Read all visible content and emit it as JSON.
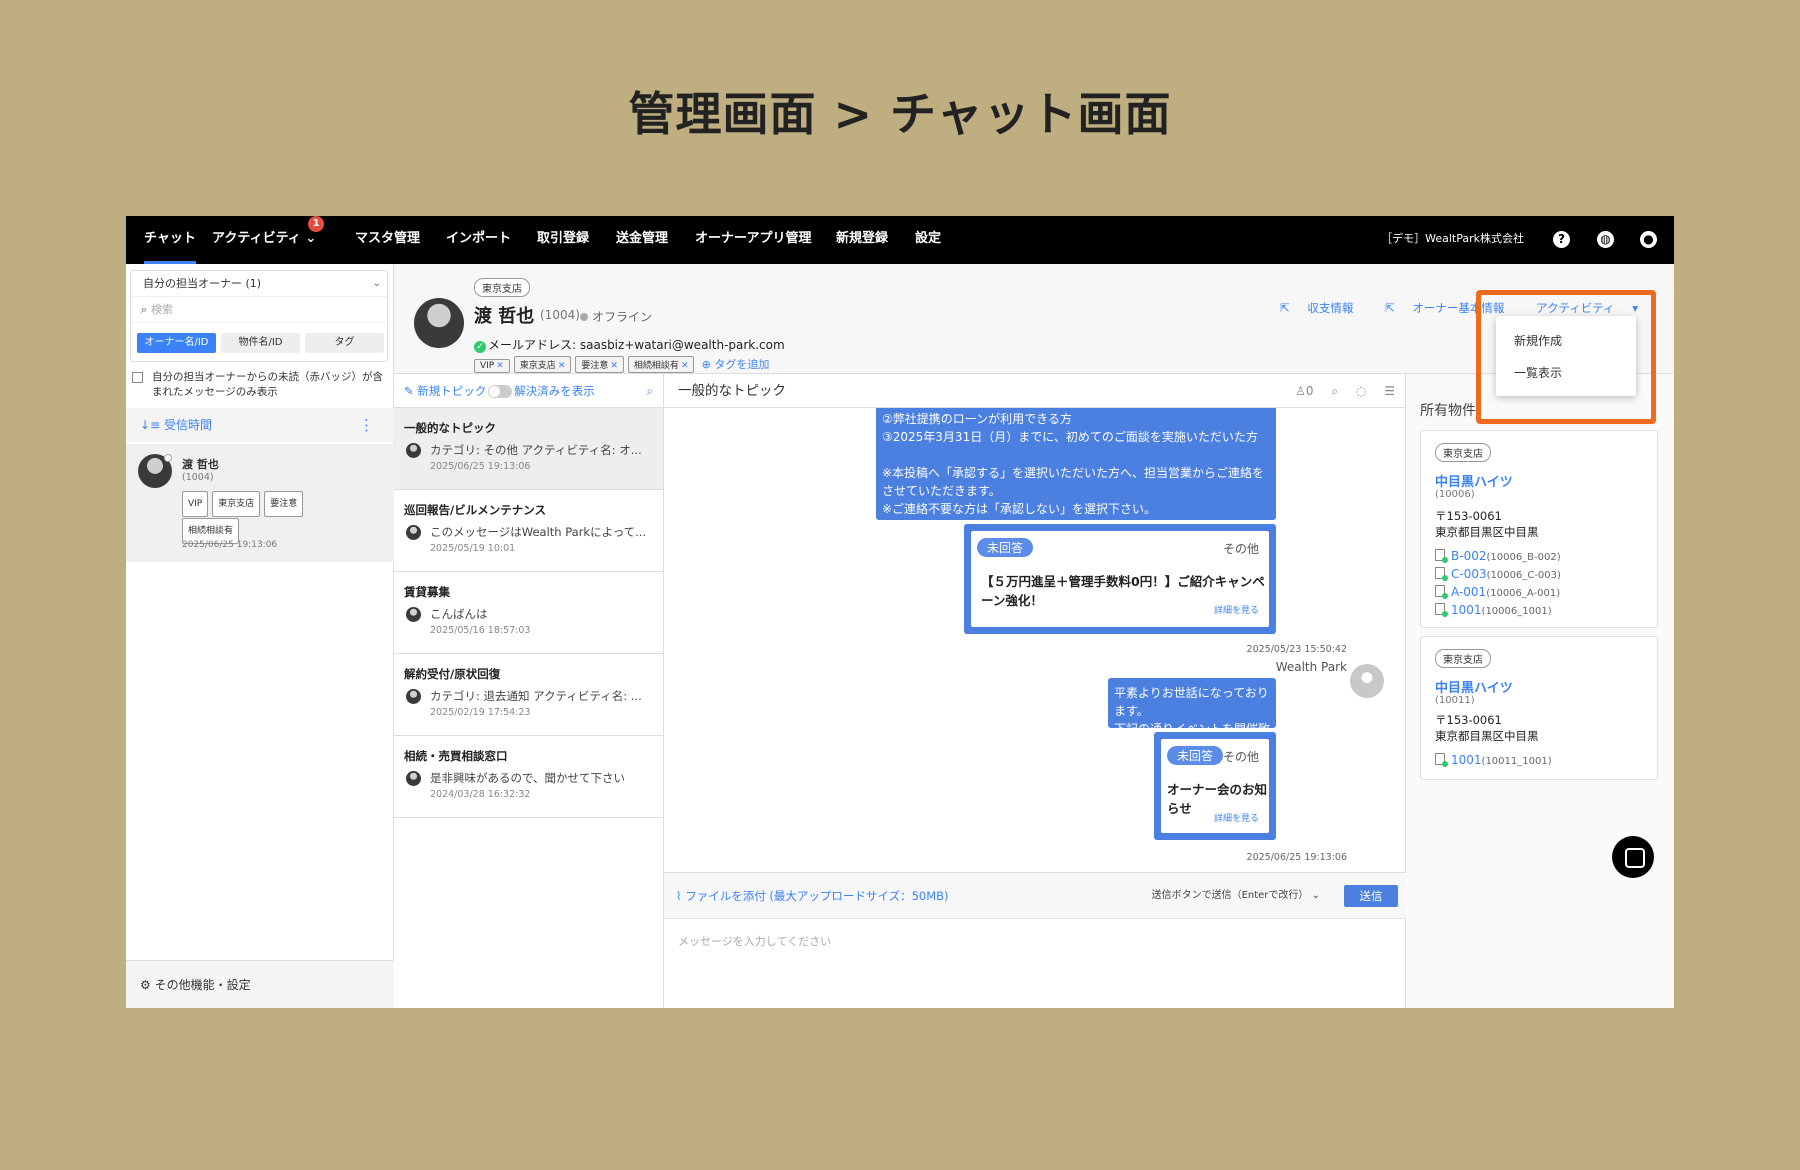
{
  "slide": {
    "title": "管理画面 > チャット画面"
  },
  "nav": {
    "items": [
      "チャット",
      "アクティビティ",
      "マスタ管理",
      "インポート",
      "取引登録",
      "送金管理",
      "オーナーアプリ管理",
      "新規登録",
      "設定"
    ],
    "activity_badge": "1",
    "company": "［デモ］WealtPark株式会社",
    "icons": [
      "help-icon",
      "globe-icon",
      "account-icon"
    ],
    "accent": "#3b82f6"
  },
  "left": {
    "owner_select": "自分の担当オーナー (1)",
    "search_placeholder": "検索",
    "segments": [
      "オーナー名/ID",
      "物件名/ID",
      "タグ"
    ],
    "unread_filter": "自分の担当オーナーからの未読（赤バッジ）が含まれたメッセージのみ表示",
    "sort_label": "受信時間",
    "contact": {
      "name": "渡 哲也",
      "id": "(1004)",
      "tags": [
        "VIP",
        "東京支店",
        "要注意",
        "相続相談有"
      ],
      "time": "2025/06/25 19:13:06"
    },
    "more": "その他機能・設定"
  },
  "header": {
    "branch": "東京支店",
    "name": "渡 哲也",
    "id": "(1004)",
    "status": "オフライン",
    "email": "メールアドレス: saasbiz+watari@wealth-park.com",
    "tags": [
      "VIP",
      "東京支店",
      "要注意",
      "相続相談有"
    ],
    "add_tag": "タグを追加",
    "links": [
      "収支情報",
      "オーナー基本情報",
      "アクティビティ"
    ],
    "dropdown": [
      "新規作成",
      "一覧表示"
    ]
  },
  "topics": {
    "new": "新規トピック",
    "resolved": "解決済みを表示",
    "items": [
      {
        "title": "一般的なトピック",
        "preview": "カテゴリ: その他 アクティビティ名: オ...",
        "time": "2025/06/25 19:13:06"
      },
      {
        "title": "巡回報告/ビルメンテナンス",
        "preview": "このメッセージはWealth Parkによって...",
        "time": "2025/05/19 10:01"
      },
      {
        "title": "賃貸募集",
        "preview": "こんばんは",
        "time": "2025/05/16 18:57:03"
      },
      {
        "title": "解約受付/原状回復",
        "preview": "カテゴリ: 退去通知 アクティビティ名: ...",
        "time": "2025/02/19 17:54:23"
      },
      {
        "title": "相続・売買相談窓口",
        "preview": "是非興味があるので、聞かせて下さい",
        "time": "2024/03/28 16:32:32"
      }
    ]
  },
  "chat": {
    "title": "一般的なトピック",
    "participants": "0",
    "msg1": [
      "②弊社提携のローンが利用できる方",
      "③2025年3月31日（月）までに、初めてのご面談を実施いただいた方",
      "",
      "※本投稿へ「承認する」を選択いただいた方へ、担当営業からご連絡をさせていただきます。",
      "※ご連絡不要な方は「承認しない」を選択下さい。"
    ],
    "card1": {
      "status": "未回答",
      "category": "その他",
      "title": "【５万円進呈＋管理手数料0円！】ご紹介キャンペーン強化！",
      "detail": "詳細を見る"
    },
    "time1": "2025/05/23 15:50:42",
    "sender": "Wealth Park",
    "msg2": [
      "平素よりお世話になっております。",
      "下記の通りイベントを開催致します。"
    ],
    "card2": {
      "status": "未回答",
      "category": "その他",
      "title": "オーナー会のお知らせ",
      "detail": "詳細を見る"
    },
    "time2": "2025/06/25 19:13:06",
    "attach": "ファイルを添付 (最大アップロードサイズ：50MB)",
    "send_mode": "送信ボタンで送信（Enterで改行）",
    "send": "送信",
    "placeholder": "メッセージを入力してください"
  },
  "props": {
    "title": "所有物件",
    "items": [
      {
        "branch": "東京支店",
        "name": "中目黒ハイツ",
        "id": "(10006)",
        "zip": "〒153-0061",
        "addr": "東京都目黒区中目黒",
        "units": [
          {
            "u": "B-002",
            "c": "(10006_B-002)"
          },
          {
            "u": "C-003",
            "c": "(10006_C-003)"
          },
          {
            "u": "A-001",
            "c": "(10006_A-001)"
          },
          {
            "u": "1001",
            "c": "(10006_1001)"
          }
        ]
      },
      {
        "branch": "東京支店",
        "name": "中目黒ハイツ",
        "id": "(10011)",
        "zip": "〒153-0061",
        "addr": "東京都目黒区中目黒",
        "units": [
          {
            "u": "1001",
            "c": "(10011_1001)"
          }
        ]
      }
    ]
  }
}
